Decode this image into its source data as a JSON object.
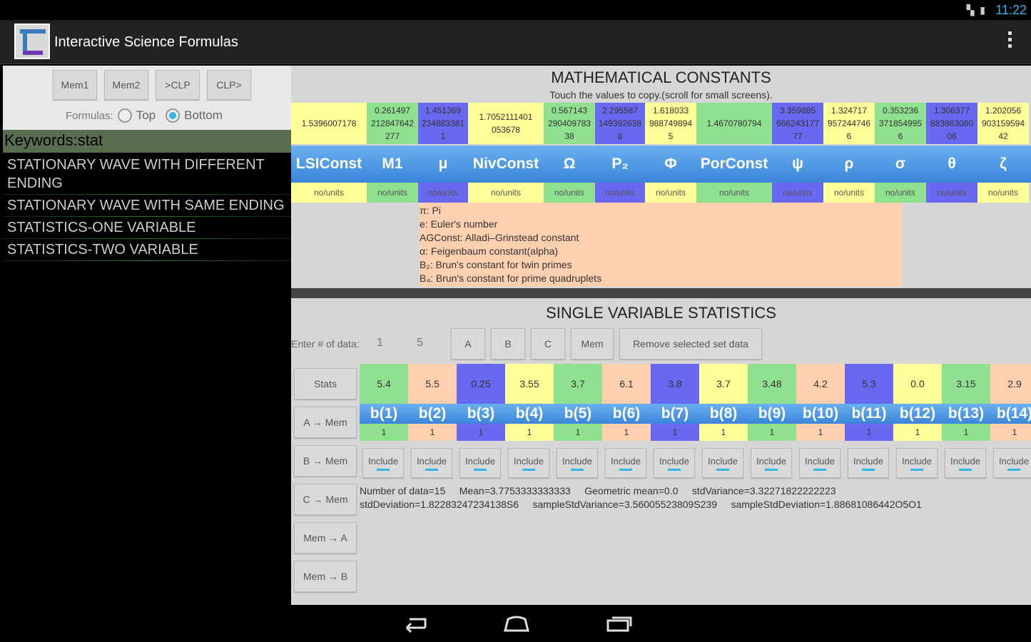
{
  "status": {
    "time": "11:22",
    "icons": "▚ ▮"
  },
  "app": {
    "title": "Interactive Science Formulas"
  },
  "left": {
    "mem_buttons": [
      "Mem1",
      "Mem2",
      ">CLP",
      "CLP>"
    ],
    "formulas_label": "Formulas:",
    "top_label": "Top",
    "bottom_label": "Bottom",
    "selected_position": "Bottom",
    "keywords": "Keywords:stat",
    "results": [
      "STATIONARY WAVE WITH DIFFERENT ENDING",
      "STATIONARY WAVE WITH SAME ENDING",
      "STATISTICS-ONE VARIABLE",
      "STATISTICS-TWO VARIABLE"
    ]
  },
  "constants": {
    "title": "MATHEMATICAL CONSTANTS",
    "subtitle": "Touch the values to copy.(scroll for small screens).",
    "values": [
      "1.5396007178",
      "0.261497\n212847642\n277",
      "1.451369\n234883381\n1",
      "1.7052111401\n053678",
      "0.567143\n290409783\n38",
      "2.295587\n149392638\n8",
      "1.618033\n988749894\n5",
      "1.4670780794",
      "3.359885\n666243177\n77",
      "1.324717\n957244746\n6",
      "0.353236\n371854995\n6",
      "1.306377\n883863080\n06",
      "1.202056\n903159594\n42"
    ],
    "value_colors": [
      "y",
      "g",
      "b",
      "y",
      "g",
      "b",
      "y",
      "g",
      "b",
      "y",
      "g",
      "b",
      "y"
    ],
    "symbols": [
      "LSIConst",
      "M1",
      "μ",
      "NivConst",
      "Ω",
      "P₂",
      "Φ",
      "PorConst",
      "ψ",
      "ρ",
      "σ",
      "θ",
      "ζ"
    ],
    "units": [
      "no/units",
      "no/units",
      "no/units",
      "no/units",
      "no/units",
      "no/units",
      "no/units",
      "no/units",
      "no/units",
      "no/units",
      "no/units",
      "no/units",
      "no/units"
    ],
    "descriptions": [
      "π: Pi",
      "e: Euler's number",
      "AGConst: Alladi–Grinstead constant",
      "α: Feigenbaum constant(alpha)",
      "B₂: Brun's constant for twin primes",
      "B₄: Brun's constant for prime quadruplets"
    ]
  },
  "stats": {
    "title": "SINGLE VARIABLE STATISTICS",
    "enter_label": "Enter # of data:",
    "field1": "1",
    "field2": "5",
    "set_buttons": [
      "A",
      "B",
      "C",
      "Mem"
    ],
    "remove_button": "Remove selected set data",
    "side_buttons": [
      "Stats",
      "A → Mem",
      "B → Mem",
      "C → Mem",
      "Mem → A",
      "Mem → B"
    ],
    "values": [
      "5.4",
      "5.5",
      "0.25",
      "3.55",
      "3.7",
      "6.1",
      "3.8",
      "3.7",
      "3.48",
      "4.2",
      "5.3",
      "0.0",
      "3.15",
      "2.9"
    ],
    "value_colors": [
      "g",
      "p",
      "b",
      "y",
      "g",
      "p",
      "b",
      "y",
      "g",
      "p",
      "b",
      "y",
      "g",
      "p"
    ],
    "b_labels": [
      "b(1)",
      "b(2)",
      "b(3)",
      "b(4)",
      "b(5)",
      "b(6)",
      "b(7)",
      "b(8)",
      "b(9)",
      "b(10)",
      "b(11)",
      "b(12)",
      "b(13)",
      "b(14)"
    ],
    "b_counts": [
      "1",
      "1",
      "1",
      "1",
      "1",
      "1",
      "1",
      "1",
      "1",
      "1",
      "1",
      "1",
      "1",
      "1"
    ],
    "include_label": "Include",
    "summary_line1": "Number of data=15     Mean=3.7753333333333     Geometric mean=0.0     stdVariance=3.32271822222223",
    "summary_line2": "stdDeviation=1.82283247234138S6     sampleStdVariance=3.56005523809S239     sampleStdDeviation=1.88681086442O5O1"
  }
}
